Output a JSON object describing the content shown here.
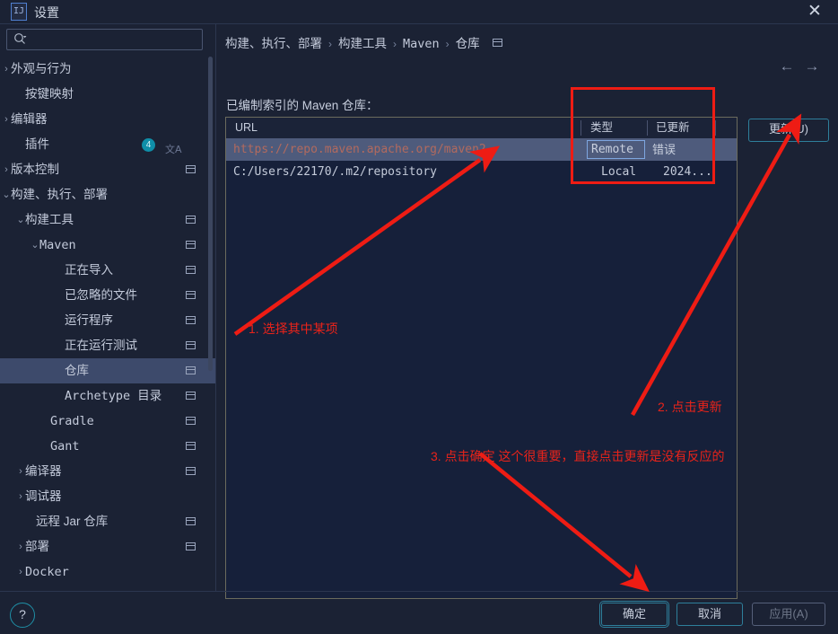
{
  "window": {
    "title": "设置",
    "app_icon": "idea-icon",
    "close_label": "✕"
  },
  "sidebar": {
    "search": {
      "placeholder": "",
      "value": "",
      "icon": "search-icon"
    },
    "items": [
      {
        "label": "外观与行为",
        "arrow": "›",
        "indent": 12,
        "expandable": true,
        "endicon": false,
        "selected": false
      },
      {
        "label": "按键映射",
        "arrow": "",
        "indent": 28,
        "expandable": false,
        "endicon": false,
        "selected": false
      },
      {
        "label": "编辑器",
        "arrow": "›",
        "indent": 12,
        "expandable": true,
        "endicon": false,
        "selected": false
      },
      {
        "label": "插件",
        "arrow": "",
        "indent": 28,
        "expandable": false,
        "endicon": false,
        "selected": false,
        "badge": "4",
        "translate_icon": "translate-icon"
      },
      {
        "label": "版本控制",
        "arrow": "›",
        "indent": 12,
        "expandable": true,
        "endicon": true,
        "selected": false
      },
      {
        "label": "构建、执行、部署",
        "arrow": "⌄",
        "indent": 12,
        "expandable": true,
        "endicon": false,
        "selected": false
      },
      {
        "label": "构建工具",
        "arrow": "⌄",
        "indent": 28,
        "expandable": true,
        "endicon": true,
        "selected": false
      },
      {
        "label": "Maven",
        "arrow": "⌄",
        "indent": 44,
        "expandable": true,
        "endicon": true,
        "selected": false,
        "mono": true
      },
      {
        "label": "正在导入",
        "arrow": "",
        "indent": 72,
        "expandable": false,
        "endicon": true,
        "selected": false
      },
      {
        "label": "已忽略的文件",
        "arrow": "",
        "indent": 72,
        "expandable": false,
        "endicon": true,
        "selected": false
      },
      {
        "label": "运行程序",
        "arrow": "",
        "indent": 72,
        "expandable": false,
        "endicon": true,
        "selected": false
      },
      {
        "label": "正在运行测试",
        "arrow": "",
        "indent": 72,
        "expandable": false,
        "endicon": true,
        "selected": false
      },
      {
        "label": "仓库",
        "arrow": "",
        "indent": 72,
        "expandable": false,
        "endicon": true,
        "selected": true
      },
      {
        "label": "Archetype 目录",
        "arrow": "",
        "indent": 72,
        "expandable": false,
        "endicon": true,
        "selected": false,
        "mono": true
      },
      {
        "label": "Gradle",
        "arrow": "",
        "indent": 56,
        "expandable": false,
        "endicon": true,
        "selected": false,
        "mono": true
      },
      {
        "label": "Gant",
        "arrow": "",
        "indent": 56,
        "expandable": false,
        "endicon": true,
        "selected": false,
        "mono": true
      },
      {
        "label": "编译器",
        "arrow": "›",
        "indent": 28,
        "expandable": true,
        "endicon": true,
        "selected": false
      },
      {
        "label": "调试器",
        "arrow": "›",
        "indent": 28,
        "expandable": true,
        "endicon": false,
        "selected": false
      },
      {
        "label": "远程 Jar 仓库",
        "arrow": "",
        "indent": 40,
        "expandable": false,
        "endicon": true,
        "selected": false
      },
      {
        "label": "部署",
        "arrow": "›",
        "indent": 28,
        "expandable": true,
        "endicon": true,
        "selected": false
      },
      {
        "label": "Docker",
        "arrow": "›",
        "indent": 28,
        "expandable": true,
        "endicon": false,
        "selected": false,
        "mono": true
      }
    ],
    "help_label": "?"
  },
  "main": {
    "breadcrumb": [
      "构建、执行、部署",
      "构建工具",
      "Maven",
      "仓库"
    ],
    "breadcrumb_separator": "›",
    "breadcrumb_icon": "collapse-icon",
    "nav_back": "←",
    "nav_forward": "→",
    "section_title": "已编制索引的 Maven 仓库：",
    "update_button": "更新(U)",
    "table": {
      "columns": [
        "URL",
        "类型",
        "已更新"
      ],
      "rows": [
        {
          "url": "https://repo.maven.apache.org/maven2",
          "type": "Remote",
          "updated": "错误",
          "selected": true
        },
        {
          "url": "C:/Users/22170/.m2/repository",
          "type": "Local",
          "updated": "2024...",
          "selected": false
        }
      ]
    }
  },
  "footer": {
    "ok": "确定",
    "cancel": "取消",
    "apply": "应用(A)"
  },
  "annotations": {
    "color": "#e8231a",
    "note1": "1. 选择其中某项",
    "note2": "2. 点击更新",
    "note3": "3. 点击确定  这个很重要，直接点击更新是没有反应的"
  }
}
